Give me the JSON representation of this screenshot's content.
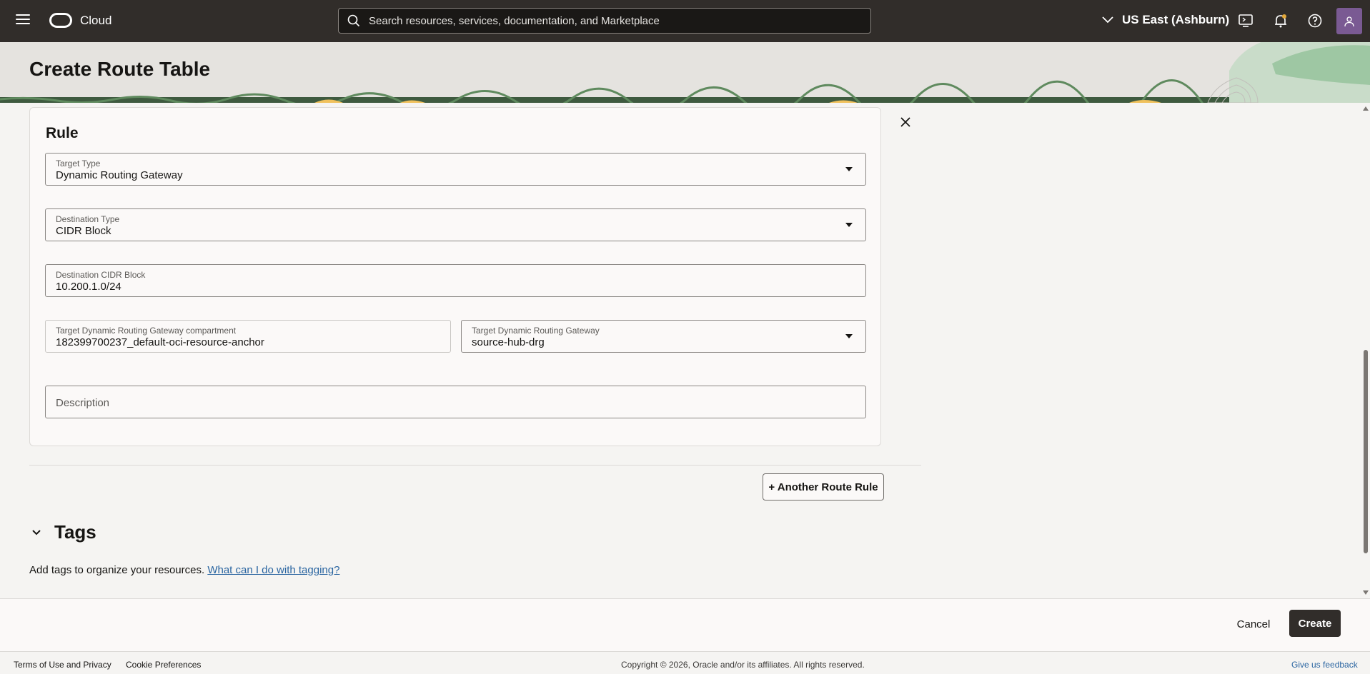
{
  "topbar": {
    "brand": "Cloud",
    "search_placeholder": "Search resources, services, documentation, and Marketplace",
    "region": "US East (Ashburn)"
  },
  "header": {
    "title": "Create Route Table"
  },
  "rule": {
    "title": "Rule",
    "target_type": {
      "label": "Target Type",
      "value": "Dynamic Routing Gateway"
    },
    "destination_type": {
      "label": "Destination Type",
      "value": "CIDR Block"
    },
    "destination_cidr": {
      "label": "Destination CIDR Block",
      "value": "10.200.1.0/24"
    },
    "drg_compartment": {
      "label": "Target Dynamic Routing Gateway compartment",
      "value": "182399700237_default-oci-resource-anchor"
    },
    "drg": {
      "label": "Target Dynamic Routing Gateway",
      "value": "source-hub-drg"
    },
    "description": {
      "placeholder": "Description"
    }
  },
  "another_rule_label": "+ Another Route Rule",
  "tags": {
    "title": "Tags",
    "text": "Add tags to organize your resources.",
    "link": "What can I do with tagging?"
  },
  "actions": {
    "cancel": "Cancel",
    "create": "Create"
  },
  "footer": {
    "terms": "Terms of Use and Privacy",
    "cookies": "Cookie Preferences",
    "copyright": "Copyright © 2026, Oracle and/or its affiliates. All rights reserved.",
    "feedback": "Give us feedback"
  },
  "colors": {
    "topbar": "#312d2a",
    "header": "#e5e3df",
    "link": "#2a65a1",
    "primary_button": "#312d2a",
    "avatar": "#7a5a93"
  }
}
